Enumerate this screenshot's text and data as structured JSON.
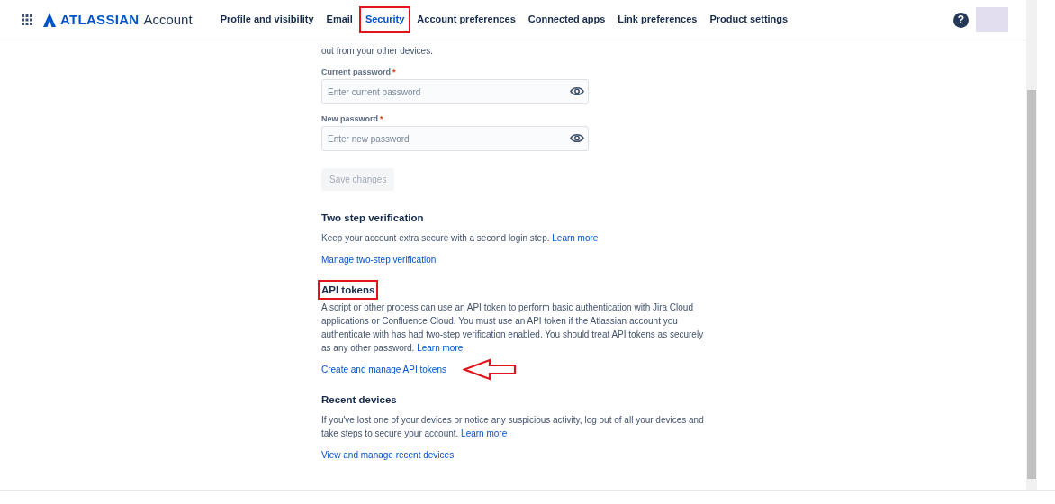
{
  "header": {
    "brand": "ATLASSIAN",
    "product": "Account",
    "tabs": [
      {
        "label": "Profile and visibility",
        "selected": false,
        "highlighted": false
      },
      {
        "label": "Email",
        "selected": false,
        "highlighted": false
      },
      {
        "label": "Security",
        "selected": true,
        "highlighted": true
      },
      {
        "label": "Account preferences",
        "selected": false,
        "highlighted": false
      },
      {
        "label": "Connected apps",
        "selected": false,
        "highlighted": false
      },
      {
        "label": "Link preferences",
        "selected": false,
        "highlighted": false
      },
      {
        "label": "Product settings",
        "selected": false,
        "highlighted": false
      }
    ],
    "help": "?"
  },
  "intro_text": "out from your other devices.",
  "fields": [
    {
      "label": "Current password",
      "required_mark": "*",
      "placeholder": "Enter current password"
    },
    {
      "label": "New password",
      "required_mark": "*",
      "placeholder": "Enter new password"
    }
  ],
  "save_button": {
    "label": "Save changes",
    "disabled": true
  },
  "sections": [
    {
      "heading": "Two step verification",
      "highlighted": false,
      "text": "Keep your account extra secure with a second login step.",
      "text_link": "Learn more",
      "action_link": "Manage two-step verification",
      "arrow": false
    },
    {
      "heading": "API tokens",
      "highlighted": true,
      "text": "A script or other process can use an API token to perform basic authentication with Jira Cloud applications or Confluence Cloud. You must use an API token if the Atlassian account you authenticate with has had two-step verification enabled. You should treat API tokens as securely as any other password.",
      "text_link": "Learn more",
      "action_link": "Create and manage API tokens",
      "arrow": true
    },
    {
      "heading": "Recent devices",
      "highlighted": false,
      "text": "If you've lost one of your devices or notice any suspicious activity, log out of all your devices and take steps to secure your account.",
      "text_link": "Learn more",
      "action_link": "View and manage recent devices",
      "arrow": false
    }
  ]
}
